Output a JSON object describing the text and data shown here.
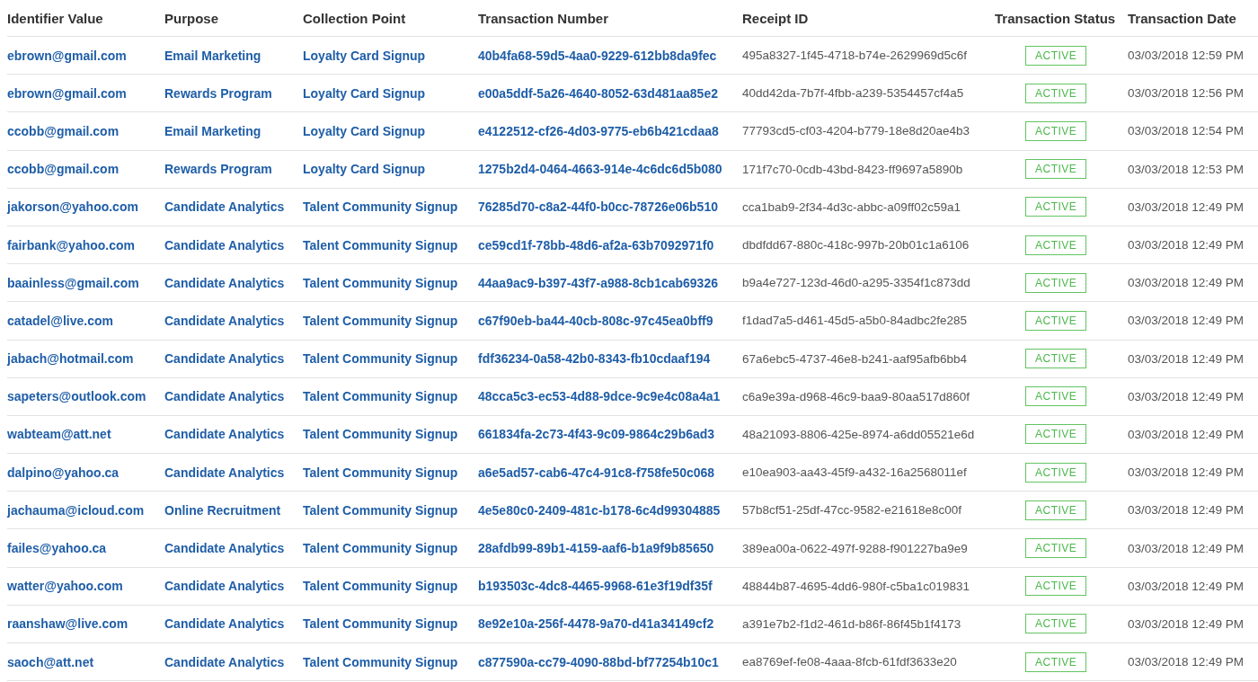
{
  "table": {
    "columns": [
      "Identifier Value",
      "Purpose",
      "Collection Point",
      "Transaction Number",
      "Receipt ID",
      "Transaction Status",
      "Transaction Date"
    ],
    "rows": [
      {
        "identifier": "ebrown@gmail.com",
        "purpose": "Email Marketing",
        "collection_point": "Loyalty Card Signup",
        "transaction_number": "40b4fa68-59d5-4aa0-9229-612bb8da9fec",
        "receipt_id": "495a8327-1f45-4718-b74e-2629969d5c6f",
        "status": "ACTIVE",
        "date": "03/03/2018 12:59 PM"
      },
      {
        "identifier": "ebrown@gmail.com",
        "purpose": "Rewards Program",
        "collection_point": "Loyalty Card Signup",
        "transaction_number": "e00a5ddf-5a26-4640-8052-63d481aa85e2",
        "receipt_id": "40dd42da-7b7f-4fbb-a239-5354457cf4a5",
        "status": "ACTIVE",
        "date": "03/03/2018 12:56 PM"
      },
      {
        "identifier": "ccobb@gmail.com",
        "purpose": "Email Marketing",
        "collection_point": "Loyalty Card Signup",
        "transaction_number": "e4122512-cf26-4d03-9775-eb6b421cdaa8",
        "receipt_id": "77793cd5-cf03-4204-b779-18e8d20ae4b3",
        "status": "ACTIVE",
        "date": "03/03/2018 12:54 PM"
      },
      {
        "identifier": "ccobb@gmail.com",
        "purpose": "Rewards Program",
        "collection_point": "Loyalty Card Signup",
        "transaction_number": "1275b2d4-0464-4663-914e-4c6dc6d5b080",
        "receipt_id": "171f7c70-0cdb-43bd-8423-ff9697a5890b",
        "status": "ACTIVE",
        "date": "03/03/2018 12:53 PM"
      },
      {
        "identifier": "jakorson@yahoo.com",
        "purpose": "Candidate Analytics",
        "collection_point": "Talent Community Signup",
        "transaction_number": "76285d70-c8a2-44f0-b0cc-78726e06b510",
        "receipt_id": "cca1bab9-2f34-4d3c-abbc-a09ff02c59a1",
        "status": "ACTIVE",
        "date": "03/03/2018 12:49 PM"
      },
      {
        "identifier": "fairbank@yahoo.com",
        "purpose": "Candidate Analytics",
        "collection_point": "Talent Community Signup",
        "transaction_number": "ce59cd1f-78bb-48d6-af2a-63b7092971f0",
        "receipt_id": "dbdfdd67-880c-418c-997b-20b01c1a6106",
        "status": "ACTIVE",
        "date": "03/03/2018 12:49 PM"
      },
      {
        "identifier": "baainless@gmail.com",
        "purpose": "Candidate Analytics",
        "collection_point": "Talent Community Signup",
        "transaction_number": "44aa9ac9-b397-43f7-a988-8cb1cab69326",
        "receipt_id": "b9a4e727-123d-46d0-a295-3354f1c873dd",
        "status": "ACTIVE",
        "date": "03/03/2018 12:49 PM"
      },
      {
        "identifier": "catadel@live.com",
        "purpose": "Candidate Analytics",
        "collection_point": "Talent Community Signup",
        "transaction_number": "c67f90eb-ba44-40cb-808c-97c45ea0bff9",
        "receipt_id": "f1dad7a5-d461-45d5-a5b0-84adbc2fe285",
        "status": "ACTIVE",
        "date": "03/03/2018 12:49 PM"
      },
      {
        "identifier": "jabach@hotmail.com",
        "purpose": "Candidate Analytics",
        "collection_point": "Talent Community Signup",
        "transaction_number": "fdf36234-0a58-42b0-8343-fb10cdaaf194",
        "receipt_id": "67a6ebc5-4737-46e8-b241-aaf95afb6bb4",
        "status": "ACTIVE",
        "date": "03/03/2018 12:49 PM"
      },
      {
        "identifier": "sapeters@outlook.com",
        "purpose": "Candidate Analytics",
        "collection_point": "Talent Community Signup",
        "transaction_number": "48cca5c3-ec53-4d88-9dce-9c9e4c08a4a1",
        "receipt_id": "c6a9e39a-d968-46c9-baa9-80aa517d860f",
        "status": "ACTIVE",
        "date": "03/03/2018 12:49 PM"
      },
      {
        "identifier": "wabteam@att.net",
        "purpose": "Candidate Analytics",
        "collection_point": "Talent Community Signup",
        "transaction_number": "661834fa-2c73-4f43-9c09-9864c29b6ad3",
        "receipt_id": "48a21093-8806-425e-8974-a6dd05521e6d",
        "status": "ACTIVE",
        "date": "03/03/2018 12:49 PM"
      },
      {
        "identifier": "dalpino@yahoo.ca",
        "purpose": "Candidate Analytics",
        "collection_point": "Talent Community Signup",
        "transaction_number": "a6e5ad57-cab6-47c4-91c8-f758fe50c068",
        "receipt_id": "e10ea903-aa43-45f9-a432-16a2568011ef",
        "status": "ACTIVE",
        "date": "03/03/2018 12:49 PM"
      },
      {
        "identifier": "jachauma@icloud.com",
        "purpose": "Online Recruitment",
        "collection_point": "Talent Community Signup",
        "transaction_number": "4e5e80c0-2409-481c-b178-6c4d99304885",
        "receipt_id": "57b8cf51-25df-47cc-9582-e21618e8c00f",
        "status": "ACTIVE",
        "date": "03/03/2018 12:49 PM"
      },
      {
        "identifier": "failes@yahoo.ca",
        "purpose": "Candidate Analytics",
        "collection_point": "Talent Community Signup",
        "transaction_number": "28afdb99-89b1-4159-aaf6-b1a9f9b85650",
        "receipt_id": "389ea00a-0622-497f-9288-f901227ba9e9",
        "status": "ACTIVE",
        "date": "03/03/2018 12:49 PM"
      },
      {
        "identifier": "watter@yahoo.com",
        "purpose": "Candidate Analytics",
        "collection_point": "Talent Community Signup",
        "transaction_number": "b193503c-4dc8-4465-9968-61e3f19df35f",
        "receipt_id": "48844b87-4695-4dd6-980f-c5ba1c019831",
        "status": "ACTIVE",
        "date": "03/03/2018 12:49 PM"
      },
      {
        "identifier": "raanshaw@live.com",
        "purpose": "Candidate Analytics",
        "collection_point": "Talent Community Signup",
        "transaction_number": "8e92e10a-256f-4478-9a70-d41a34149cf2",
        "receipt_id": "a391e7b2-f1d2-461d-b86f-86f45b1f4173",
        "status": "ACTIVE",
        "date": "03/03/2018 12:49 PM"
      },
      {
        "identifier": "saoch@att.net",
        "purpose": "Candidate Analytics",
        "collection_point": "Talent Community Signup",
        "transaction_number": "c877590a-cc79-4090-88bd-bf77254b10c1",
        "receipt_id": "ea8769ef-fe08-4aaa-8fcb-61fdf3633e20",
        "status": "ACTIVE",
        "date": "03/03/2018 12:49 PM"
      }
    ]
  }
}
